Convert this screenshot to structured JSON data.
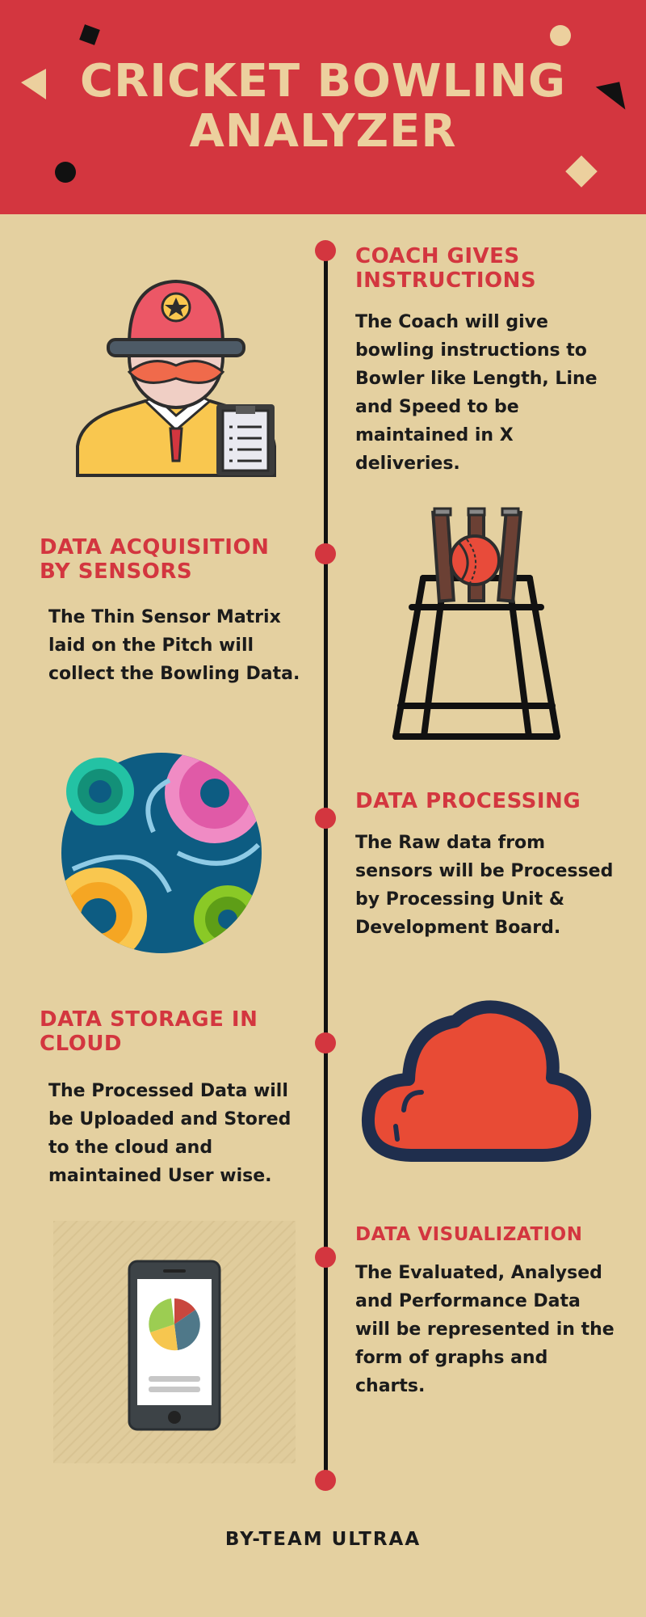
{
  "header": {
    "title_line1": "CRICKET BOWLING",
    "title_line2": "ANALYZER",
    "background_color": "#d3363f",
    "title_color": "#ecd09e"
  },
  "steps": [
    {
      "title_line1": "COACH GIVES",
      "title_line2": "INSTRUCTIONS",
      "body_lines": [
        "The Coach will give",
        "bowling instructions to",
        "Bowler like Length, Line",
        "and Speed to be",
        "maintained in X",
        "deliveries."
      ],
      "icon": "coach-icon"
    },
    {
      "title_line1": "DATA  ACQUISITION",
      "title_line2": "BY SENSORS",
      "body_lines": [
        "The Thin Sensor Matrix",
        "laid on the Pitch will",
        "collect the Bowling Data."
      ],
      "icon": "wickets-ball-icon"
    },
    {
      "title_line1": "DATA PROCESSING",
      "title_line2": "",
      "body_lines": [
        "The Raw data from",
        "sensors will be Processed",
        "by Processing Unit  &",
        "Development Board."
      ],
      "icon": "gears-icon"
    },
    {
      "title_line1": "DATA  STORAGE IN",
      "title_line2": "CLOUD",
      "body_lines": [
        "The Processed Data will",
        "be Uploaded and Stored",
        "to the cloud and",
        "maintained User wise."
      ],
      "icon": "cloud-icon"
    },
    {
      "title_line1": "DATA VISUALIZATION",
      "title_line2": "",
      "body_lines": [
        "The Evaluated, Analysed",
        "and Performance Data",
        "will be represented in the",
        "form of graphs and",
        "charts."
      ],
      "icon": "phone-pie-chart-icon"
    }
  ],
  "footer": {
    "text": "BY-TEAM ULTRAA"
  },
  "colors": {
    "accent": "#d3363f",
    "background": "#e4d0a0",
    "text": "#1b1b1b"
  }
}
